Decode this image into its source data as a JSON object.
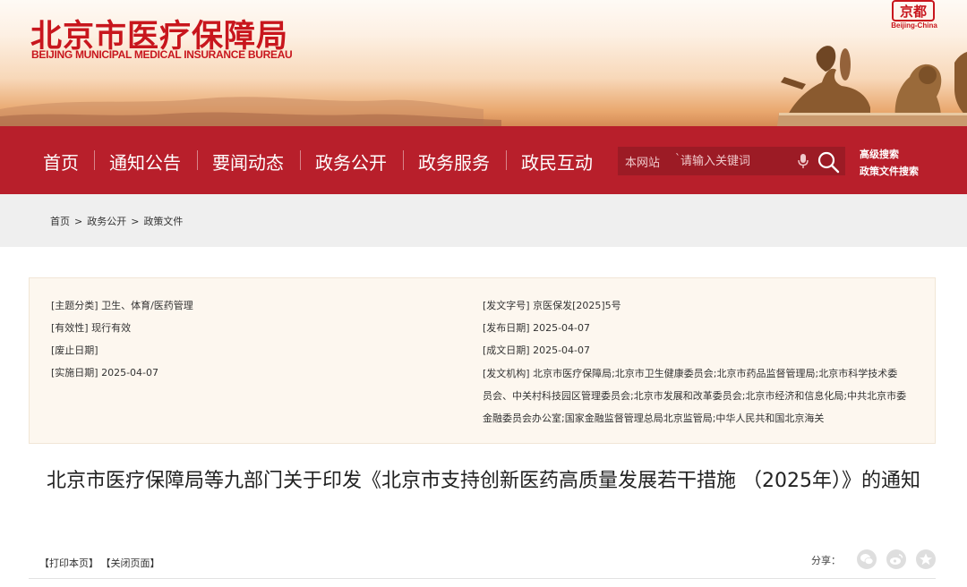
{
  "header": {
    "logo_cn": "北京市医疗保障局",
    "logo_en": "BEIJING MUNICIPAL MEDICAL INSURANCE BUREAU",
    "seal_text": "Beijing-China",
    "seal_icon": "beijing-seal-icon",
    "brand_color": "#c8161d"
  },
  "nav": {
    "color": "#b81f2b",
    "items": [
      "首页",
      "通知公告",
      "要闻动态",
      "政务公开",
      "政务服务",
      "政民互动"
    ],
    "search_scope": "本网站",
    "search_placeholder": "请输入关键词",
    "advanced_search": "高级搜索",
    "policy_search": "政策文件搜索"
  },
  "breadcrumb": [
    "首页",
    "政务公开",
    "政策文件"
  ],
  "info": {
    "left": [
      {
        "label": "[主题分类]",
        "value": "卫生、体育/医药管理"
      },
      {
        "label": "[有效性]",
        "value": "现行有效"
      },
      {
        "label": "[废止日期]",
        "value": ""
      },
      {
        "label": "[实施日期]",
        "value": "2025-04-07"
      }
    ],
    "right": [
      {
        "label": "[发文字号]",
        "value": "京医保发[2025]5号"
      },
      {
        "label": "[发布日期]",
        "value": "2025-04-07"
      },
      {
        "label": "[成文日期]",
        "value": "2025-04-07"
      }
    ],
    "issuer_label": "[发文机构]",
    "issuer_value": "北京市医疗保障局;北京市卫生健康委员会;北京市药品监督管理局;北京市科学技术委员会、中关村科技园区管理委员会;北京市发展和改革委员会;北京市经济和信息化局;中共北京市委金融委员会办公室;国家金融监督管理总局北京监管局;中华人民共和国北京海关"
  },
  "document": {
    "title": "北京市医疗保障局等九部门关于印发《北京市支持创新医药高质量发展若干措施 （2025年）》的通知"
  },
  "tools": {
    "print": "【打印本页】",
    "close": "【关闭页面】",
    "share_label": "分享：",
    "share_icons": [
      "wechat-icon",
      "weibo-icon",
      "qzone-icon"
    ]
  }
}
